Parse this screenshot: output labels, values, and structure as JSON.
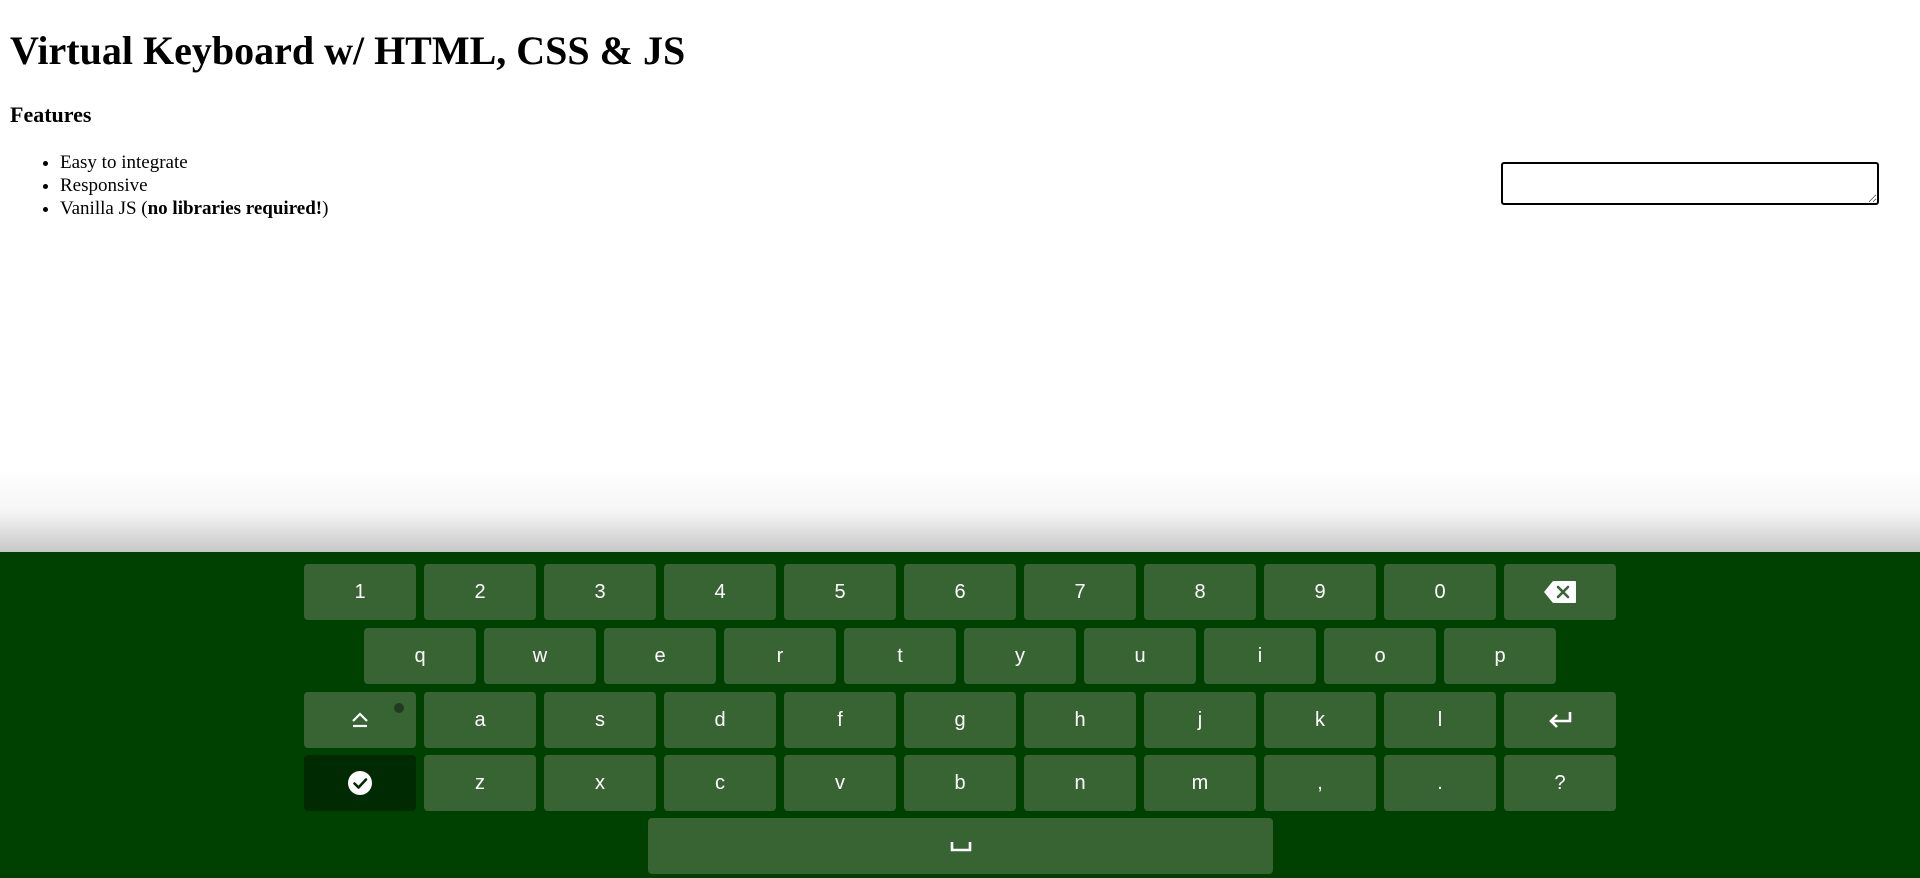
{
  "page": {
    "title": "Virtual Keyboard w/ HTML, CSS & JS",
    "features_heading": "Features",
    "features": [
      "Easy to integrate",
      "Responsive"
    ],
    "feature_vanilla_prefix": "Vanilla JS (",
    "feature_vanilla_bold": "no libraries required!",
    "feature_vanilla_suffix": ")"
  },
  "textarea": {
    "value": ""
  },
  "keyboard": {
    "background": "#004102",
    "key_color": "#386434",
    "done_key_color": "#002a01",
    "row1": [
      "1",
      "2",
      "3",
      "4",
      "5",
      "6",
      "7",
      "8",
      "9",
      "0"
    ],
    "backspace_icon": "backspace-icon",
    "row2": [
      "q",
      "w",
      "e",
      "r",
      "t",
      "y",
      "u",
      "i",
      "o",
      "p"
    ],
    "caps_icon": "caps-lock-icon",
    "row3": [
      "a",
      "s",
      "d",
      "f",
      "g",
      "h",
      "j",
      "k",
      "l"
    ],
    "enter_icon": "enter-icon",
    "done_icon": "check-circle-icon",
    "row4": [
      "z",
      "x",
      "c",
      "v",
      "b",
      "n",
      "m",
      ",",
      ".",
      "?"
    ],
    "space_label": "␣"
  }
}
